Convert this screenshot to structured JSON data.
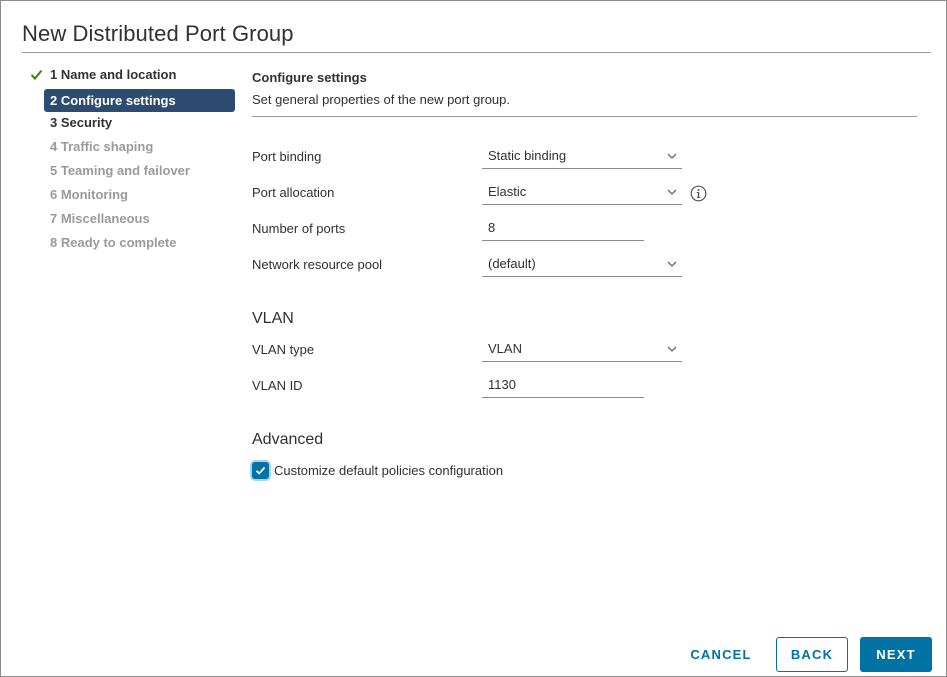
{
  "dialog": {
    "title": "New Distributed Port Group"
  },
  "steps": [
    {
      "label": "1 Name and location",
      "state": "done"
    },
    {
      "label": "2 Configure settings",
      "state": "active"
    },
    {
      "label": "3 Security",
      "state": "enabled"
    },
    {
      "label": "4 Traffic shaping",
      "state": "future"
    },
    {
      "label": "5 Teaming and failover",
      "state": "future"
    },
    {
      "label": "6 Monitoring",
      "state": "future"
    },
    {
      "label": "7 Miscellaneous",
      "state": "future"
    },
    {
      "label": "8 Ready to complete",
      "state": "future"
    }
  ],
  "section": {
    "title": "Configure settings",
    "description": "Set general properties of the new port group."
  },
  "fields": {
    "port_binding": {
      "label": "Port binding",
      "value": "Static binding"
    },
    "port_allocation": {
      "label": "Port allocation",
      "value": "Elastic"
    },
    "number_of_ports": {
      "label": "Number of ports",
      "value": "8"
    },
    "network_resource_pool": {
      "label": "Network resource pool",
      "value": "(default)"
    }
  },
  "vlan": {
    "heading": "VLAN",
    "type": {
      "label": "VLAN type",
      "value": "VLAN"
    },
    "id": {
      "label": "VLAN ID",
      "value": "1130"
    }
  },
  "advanced": {
    "heading": "Advanced",
    "customize_label": "Customize default policies configuration",
    "customize_checked": true
  },
  "buttons": {
    "cancel": "CANCEL",
    "back": "BACK",
    "next": "NEXT"
  },
  "colors": {
    "primary": "#0072a3",
    "active_step": "#2e4c72",
    "check": "#3c8500"
  },
  "icons": {
    "done": "check-icon",
    "info": "info-icon",
    "dropdown": "chevron-down-icon"
  }
}
